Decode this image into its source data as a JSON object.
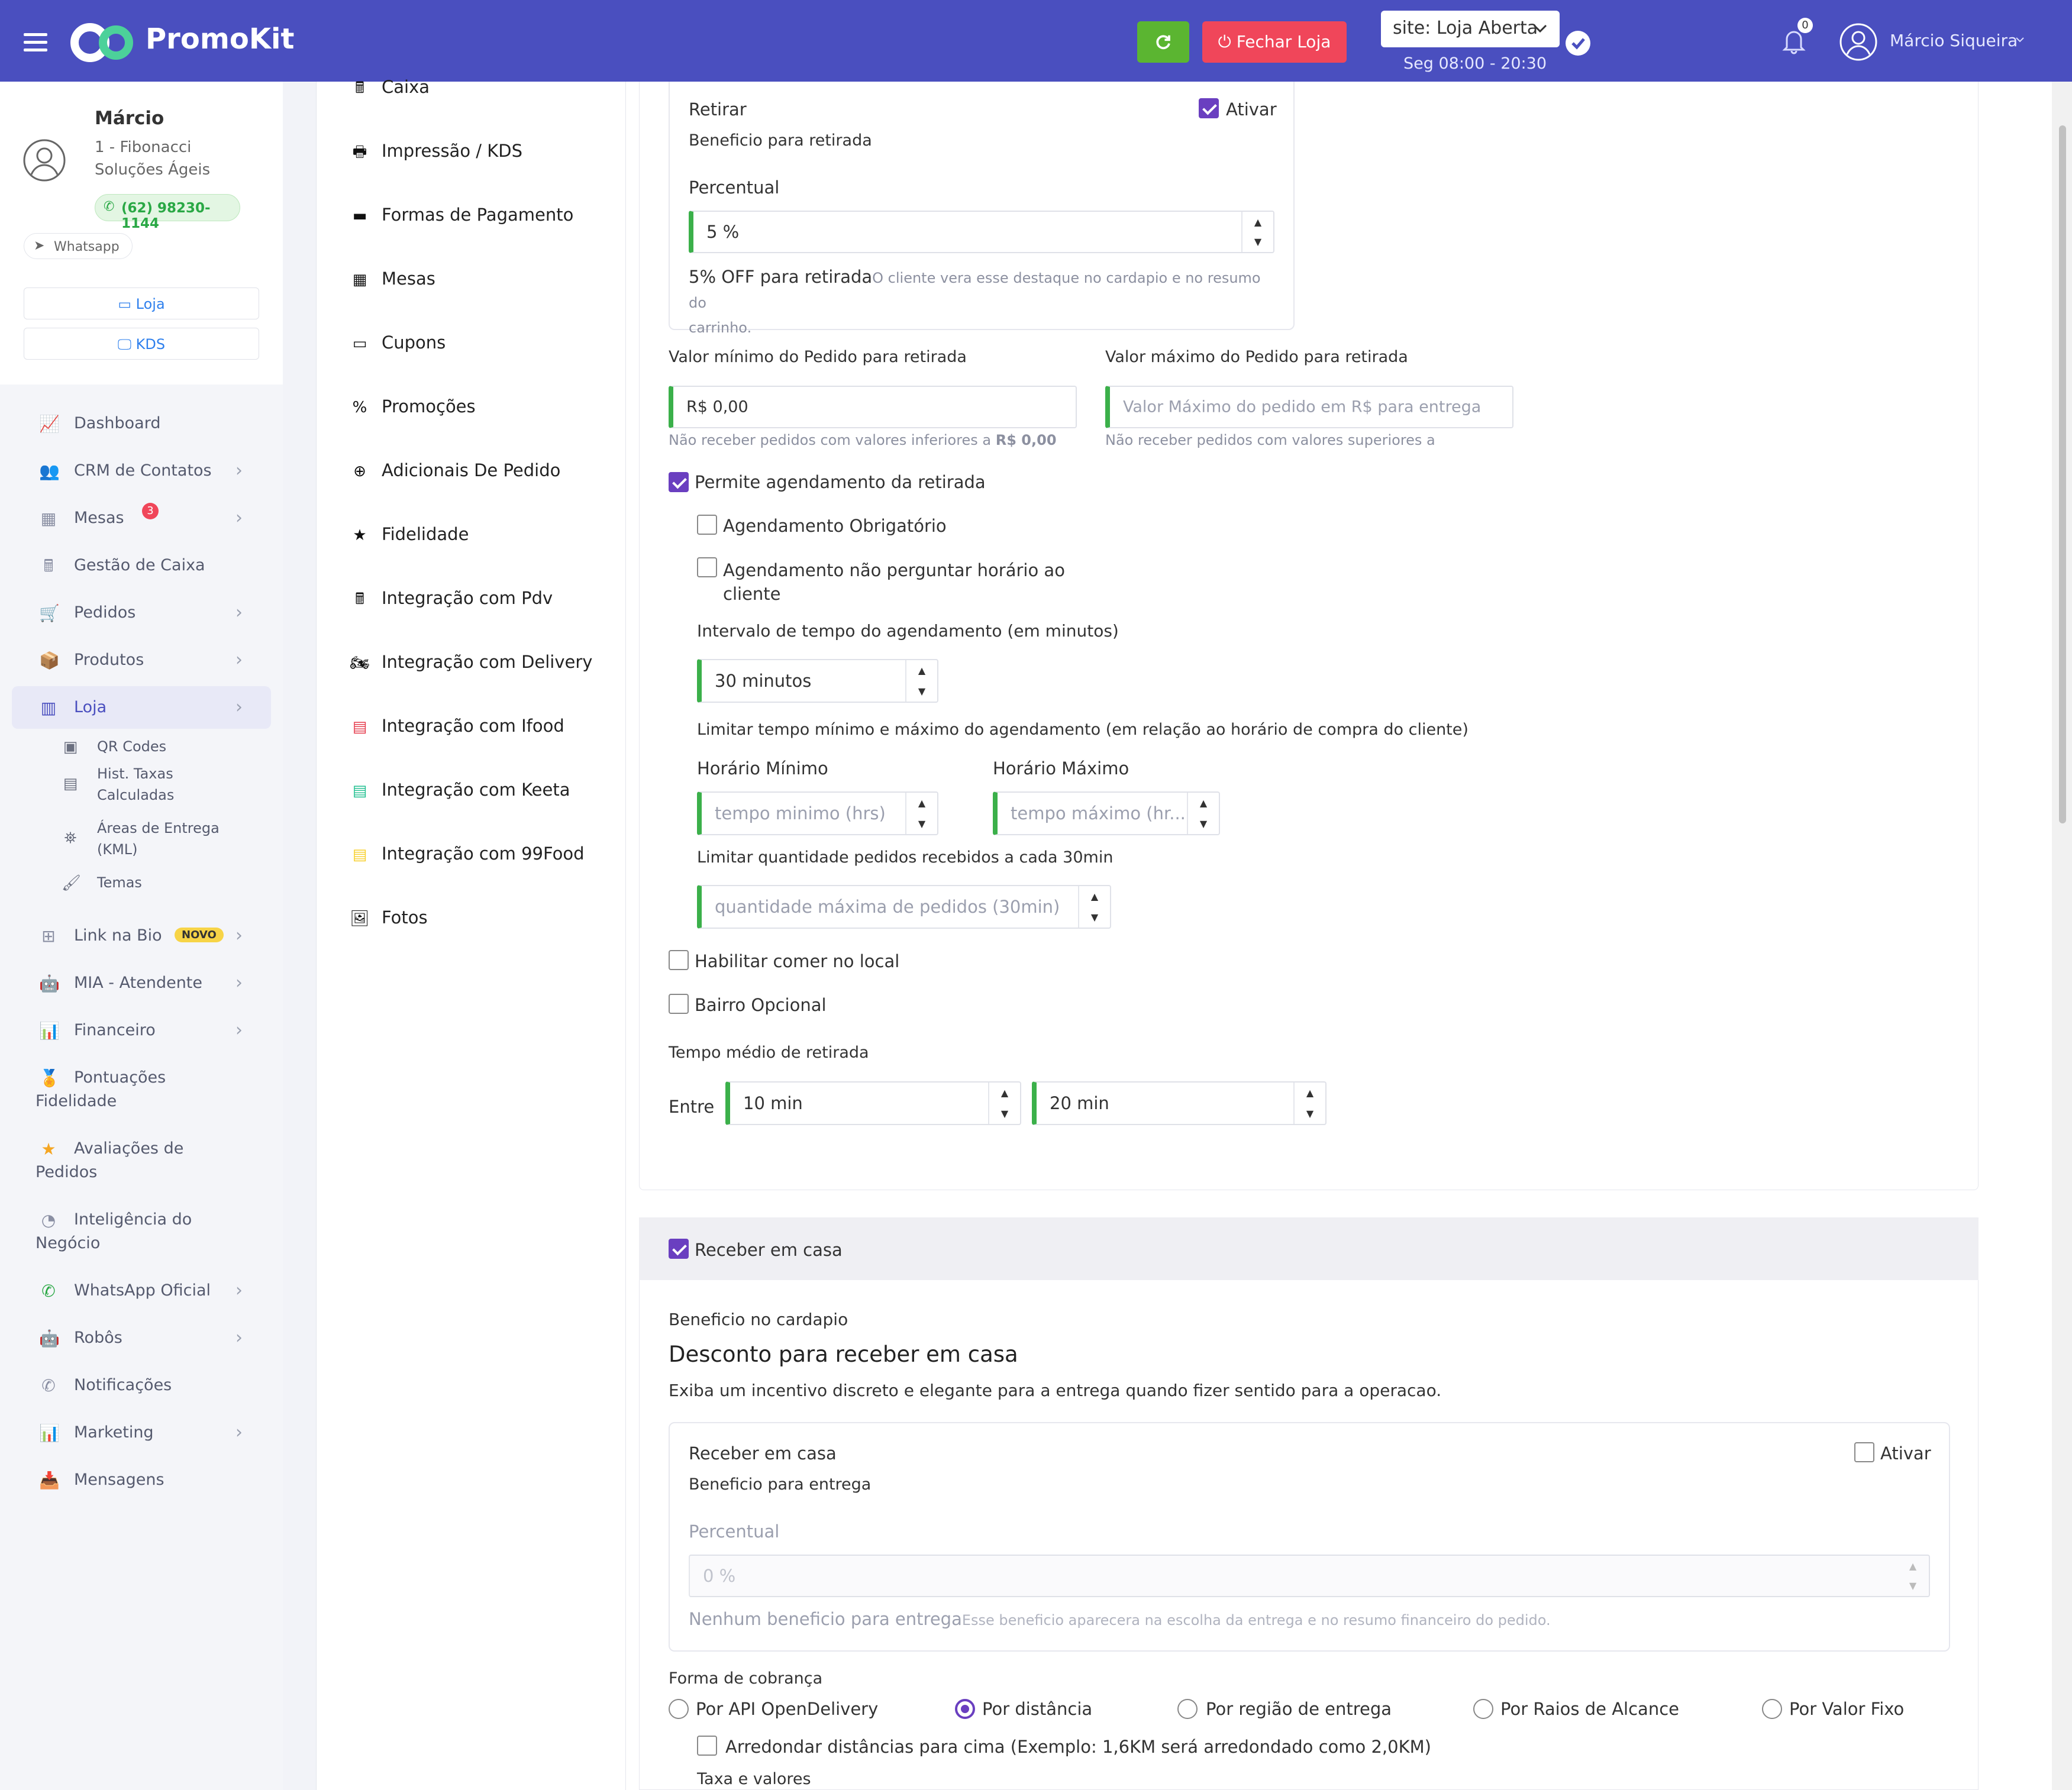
{
  "topbar": {
    "logo": "PromoKit",
    "close_store": "Fechar Loja",
    "site_status": "site: Loja Aberta",
    "hours": "Seg 08:00 - 20:30",
    "notif_count": "0",
    "user_name": "Márcio Siqueira",
    "colors": {
      "bar": "#4a4fbf",
      "refresh": "#5bb531",
      "close": "#f0465a"
    }
  },
  "profile": {
    "name": "Márcio",
    "company_line1": "1 - Fibonacci",
    "company_line2": "Soluções Ágeis",
    "phone": "(62) 98230-1144",
    "whatsapp": "Whatsapp",
    "btn_loja": "Loja",
    "btn_kds": "KDS"
  },
  "nav": {
    "dashboard": "Dashboard",
    "crm": "CRM de Contatos",
    "mesas": "Mesas",
    "mesas_badge": "3",
    "caixa": "Gestão de Caixa",
    "pedidos": "Pedidos",
    "produtos": "Produtos",
    "loja": "Loja",
    "sub": {
      "qr": "QR Codes",
      "taxas1": "Hist. Taxas",
      "taxas2": "Calculadas",
      "areas1": "Áreas de Entrega",
      "areas2": "(KML)",
      "temas": "Temas"
    },
    "link_bio": "Link na Bio",
    "novo": "NOVO",
    "mia": "MIA - Atendente",
    "financeiro": "Financeiro",
    "pont1": "Pontuações",
    "pont2": "Fidelidade",
    "aval1": "Avaliações de",
    "aval2": "Pedidos",
    "intel1": "Inteligência do",
    "intel2": "Negócio",
    "whatsapp_oficial": "WhatsApp Oficial",
    "robos": "Robôs",
    "notificacoes": "Notificações",
    "marketing": "Marketing",
    "mensagens": "Mensagens"
  },
  "menu": {
    "caixa": "Caixa",
    "impressao": "Impressão / KDS",
    "pagamento": "Formas de Pagamento",
    "mesas": "Mesas",
    "cupons": "Cupons",
    "promocoes": "Promoções",
    "adicionais": "Adicionais De Pedido",
    "fidelidade": "Fidelidade",
    "pdv": "Integração com Pdv",
    "delivery": "Integração com Delivery",
    "ifood": "Integração com Ifood",
    "keeta": "Integração com Keeta",
    "food99": "Integração com 99Food",
    "fotos": "Fotos"
  },
  "retirada": {
    "title": "Retirar",
    "ativar": "Ativar",
    "beneficio": "Beneficio para retirada",
    "percentual_label": "Percentual",
    "percentual_value": "5 %",
    "resumo_strong": "5% OFF para retirada",
    "resumo_text1": "O cliente vera esse destaque no cardapio e no resumo do",
    "resumo_text2": "carrinho.",
    "min_label": "Valor mínimo do Pedido para retirada",
    "min_value": "R$ 0,00",
    "min_hint": "Não receber pedidos com valores inferiores a ",
    "min_hint_strong": "R$ 0,00",
    "max_label": "Valor máximo do Pedido para retirada",
    "max_placeholder": "Valor Máximo do pedido em R$ para entrega",
    "max_hint": "Não receber pedidos com valores superiores a",
    "agendamento": "Permite agendamento da retirada",
    "ag_obrigatorio": "Agendamento Obrigatório",
    "ag_nao_perguntar1": "Agendamento não perguntar horário ao",
    "ag_nao_perguntar2": "cliente",
    "intervalo_label": "Intervalo de tempo do agendamento (em minutos)",
    "intervalo_value": "30 minutos",
    "limitar_label": "Limitar tempo mínimo e máximo do agendamento (em relação ao horário de compra do cliente)",
    "hmin_label": "Horário Mínimo",
    "hmin_placeholder": "tempo minimo (hrs)",
    "hmax_label": "Horário Máximo",
    "hmax_placeholder": "tempo máximo (hr...",
    "limitar_qtd_label": "Limitar quantidade pedidos recebidos a cada 30min",
    "qtd_placeholder": "quantidade máxima de pedidos (30min)",
    "comer_local": "Habilitar comer no local",
    "bairro_opcional": "Bairro Opcional",
    "tempo_label": "Tempo médio de retirada",
    "entre": "Entre",
    "tempo_min": "10 min",
    "tempo_max": "20 min"
  },
  "entrega": {
    "header": "Receber em casa",
    "beneficio_cardapio": "Beneficio no cardapio",
    "desconto_title": "Desconto para receber em casa",
    "desconto_desc": "Exiba um incentivo discreto e elegante para a entrega quando fizer sentido para a operacao.",
    "box_title": "Receber em casa",
    "ativar": "Ativar",
    "beneficio": "Beneficio para entrega",
    "percentual_label": "Percentual",
    "percentual_placeholder": "0 %",
    "resumo_strong": "Nenhum beneficio para entrega",
    "resumo_text": "Esse beneficio aparecera na escolha da entrega e no resumo financeiro do pedido.",
    "forma_label": "Forma de cobrança",
    "radios": [
      "Por API OpenDelivery",
      "Por distância",
      "Por região de entrega",
      "Por Raios de Alcance",
      "Por Valor Fixo"
    ],
    "arredondar": "Arredondar distâncias para cima (Exemplo: 1,6KM será arredondado como 2,0KM)",
    "taxa_label": "Taxa e valores"
  }
}
